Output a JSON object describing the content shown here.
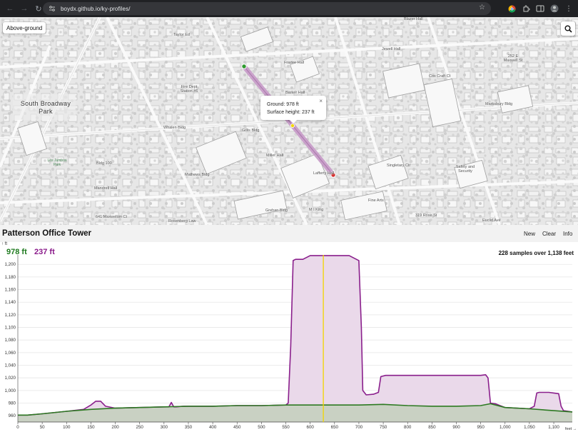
{
  "browser": {
    "url": "boydx.github.io/ky-profiles/"
  },
  "map": {
    "mode_button": "Above-ground",
    "labels": [
      {
        "text": "Taylor Ed",
        "cls": "a"
      },
      {
        "text": "Frazee Hall",
        "cls": "b"
      },
      {
        "text": "Jewell Hall",
        "cls": "c"
      },
      {
        "text": "Blazer Hall",
        "cls": "d"
      },
      {
        "text": "Fire Dept Station #6",
        "cls": "e"
      },
      {
        "text": "Barker Hall",
        "cls": "f"
      },
      {
        "text": "Whalen Bldg",
        "cls": "g"
      },
      {
        "text": "Gillis Bldg",
        "cls": "h"
      },
      {
        "text": "Miller Hall",
        "cls": "i"
      },
      {
        "text": "Bldg 100",
        "cls": "j"
      },
      {
        "text": "Mathews Bldg",
        "cls": "k"
      },
      {
        "text": "Mandrell Hall",
        "cls": "l"
      },
      {
        "text": "Lafferty Hall",
        "cls": "m"
      },
      {
        "text": "Singletary Ctr",
        "cls": "n"
      },
      {
        "text": "Fine Arts",
        "cls": "o"
      },
      {
        "text": "Grehan Bldg",
        "cls": "p"
      },
      {
        "text": "M I King",
        "cls": "q"
      },
      {
        "text": "Rosenberg Law",
        "cls": "r"
      },
      {
        "text": "641 Maxwelton Ct",
        "cls": "s"
      },
      {
        "text": "Cox Craft Ct",
        "cls": "t"
      },
      {
        "text": "Marksbury Bldg",
        "cls": "u"
      },
      {
        "text": "252 E Maxwell St",
        "cls": "v"
      },
      {
        "text": "Safety and Security",
        "cls": "w"
      },
      {
        "text": "319 Rose St",
        "cls": "x"
      },
      {
        "text": "Euclid Ave",
        "cls": "y"
      }
    ],
    "park_name": "South Broadway Park",
    "park_secondary": "Los Jumbos Park",
    "popup": {
      "ground": "Ground: 978 ft",
      "surface": "Surface height: 237 ft"
    }
  },
  "panel": {
    "title": "Patterson Office Tower",
    "buttons": [
      "New",
      "Clear",
      "Info"
    ],
    "ground_value": "978 ft",
    "surface_value": "237 ft",
    "stats": "228 samples over 1,138 feet",
    "y_unit": "ft",
    "x_unit": "feet"
  },
  "colors": {
    "ground_line": "#2d7a22",
    "ground_fill": "#c9d1c3",
    "surface_line": "#8a1f8c",
    "surface_fill": "#ead9ea",
    "cursor": "#f2d600",
    "grid": "#e6e6e6"
  },
  "chart_data": {
    "type": "area",
    "title": "Patterson Office Tower",
    "xlabel": "feet",
    "ylabel": "ft",
    "xlim": [
      0,
      1138
    ],
    "ylim": [
      950,
      1215
    ],
    "x_ticks": [
      0,
      50,
      100,
      150,
      200,
      250,
      300,
      350,
      400,
      450,
      500,
      550,
      600,
      650,
      700,
      750,
      800,
      850,
      900,
      950,
      1000,
      1050,
      1100
    ],
    "x_tick_labels": [
      "0",
      "50",
      "100",
      "150",
      "200",
      "250",
      "300",
      "350",
      "400",
      "450",
      "500",
      "550",
      "600",
      "650",
      "700",
      "750",
      "800",
      "850",
      "900",
      "950",
      "1,000",
      "1,050",
      "1,100"
    ],
    "y_ticks": [
      960,
      980,
      1000,
      1020,
      1040,
      1060,
      1080,
      1100,
      1120,
      1140,
      1160,
      1180,
      1200
    ],
    "y_tick_labels": [
      "960",
      "980",
      "1,000",
      "1,020",
      "1,040",
      "1,060",
      "1,080",
      "1,100",
      "1,120",
      "1,140",
      "1,160",
      "1,180",
      "1,200"
    ],
    "cursor_x": 627,
    "series": [
      {
        "name": "Ground",
        "x": [
          0,
          20,
          50,
          100,
          150,
          200,
          250,
          300,
          350,
          400,
          450,
          500,
          550,
          600,
          650,
          700,
          750,
          800,
          850,
          900,
          950,
          970,
          1000,
          1050,
          1100,
          1138
        ],
        "y": [
          961,
          961,
          963,
          967,
          970,
          972,
          973,
          974,
          975,
          975,
          976,
          976,
          977,
          977,
          977,
          977,
          978,
          976,
          975,
          975,
          976,
          979,
          973,
          971,
          968,
          966
        ]
      },
      {
        "name": "Surface",
        "x": [
          0,
          20,
          50,
          100,
          135,
          150,
          160,
          170,
          180,
          200,
          250,
          300,
          310,
          315,
          320,
          325,
          340,
          400,
          450,
          500,
          550,
          555,
          560,
          565,
          570,
          585,
          600,
          650,
          680,
          690,
          700,
          705,
          708,
          715,
          730,
          740,
          745,
          755,
          800,
          850,
          900,
          950,
          960,
          965,
          970,
          980,
          1000,
          1050,
          1060,
          1065,
          1070,
          1090,
          1100,
          1110,
          1115,
          1120,
          1138
        ],
        "y": [
          961,
          961,
          963,
          967,
          970,
          977,
          983,
          983,
          975,
          972,
          973,
          974,
          974,
          981,
          974,
          974,
          975,
          975,
          976,
          976,
          977,
          980,
          1070,
          1206,
          1208,
          1208,
          1214,
          1214,
          1214,
          1210,
          1206,
          1100,
          1000,
          993,
          994,
          997,
          1022,
          1024,
          1024,
          1024,
          1024,
          1024,
          1025,
          1020,
          980,
          979,
          973,
          971,
          975,
          996,
          997,
          997,
          996,
          995,
          975,
          968,
          966
        ]
      }
    ]
  }
}
